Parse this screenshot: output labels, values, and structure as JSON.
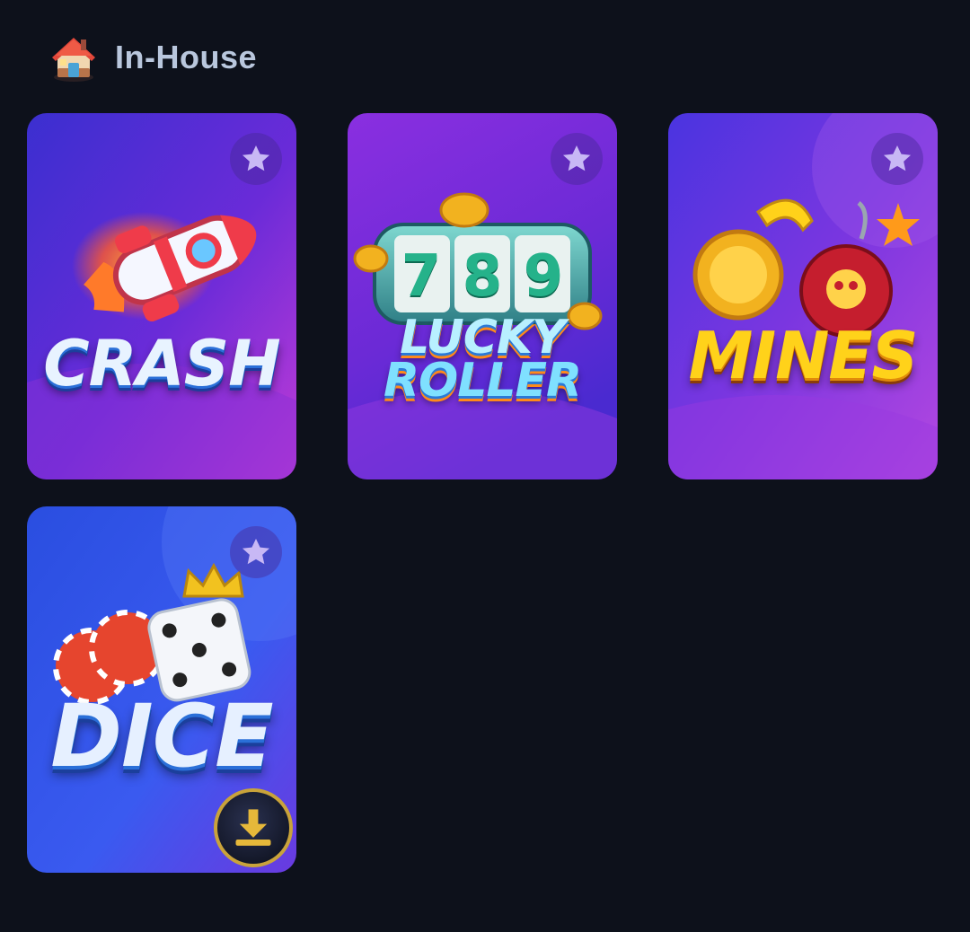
{
  "section": {
    "title": "In-House",
    "icon": "house-icon"
  },
  "games": [
    {
      "id": "crash",
      "title": "CRASH",
      "favorited": false
    },
    {
      "id": "lucky-roller",
      "title_line1": "LUCKY",
      "title_line2": "ROLLER",
      "reels": [
        "7",
        "8",
        "9"
      ],
      "favorited": false
    },
    {
      "id": "mines",
      "title": "MINES",
      "favorited": false
    },
    {
      "id": "dice",
      "title": "DICE",
      "favorited": false,
      "download_icon": "download-icon"
    }
  ],
  "colors": {
    "background": "#0d111b",
    "section_title": "#b9c7dd",
    "star": "#c8b8f5",
    "download_border": "#c9a33a",
    "download_arrow": "#e6b83a"
  }
}
